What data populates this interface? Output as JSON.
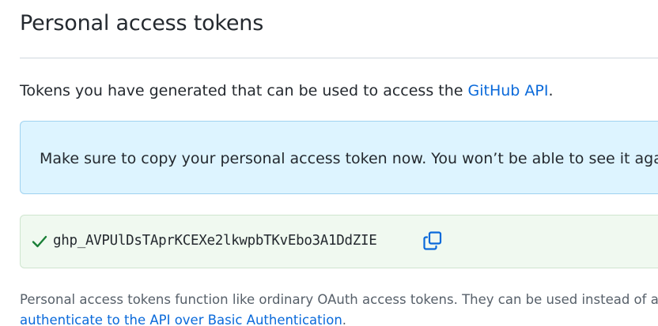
{
  "header": {
    "title": "Personal access tokens"
  },
  "intro": {
    "text": "Tokens you have generated that can be used to access the ",
    "link_text": "GitHub API",
    "suffix": "."
  },
  "notice": {
    "text": "Make sure to copy your personal access token now. You won’t be able to see it again"
  },
  "token": {
    "value": "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",
    "status_icon": "check-icon",
    "copy_icon": "copy-icon"
  },
  "footer": {
    "line1": "Personal access tokens function like ordinary OAuth access tokens. They can be used instead of a pass",
    "link_text": "authenticate to the API over Basic Authentication",
    "suffix": "."
  },
  "colors": {
    "link": "#0969da",
    "notice_bg": "#ddf4ff",
    "success_bg": "#f0f9f0",
    "success_icon": "#1a7f37",
    "copy_icon": "#0969da"
  }
}
